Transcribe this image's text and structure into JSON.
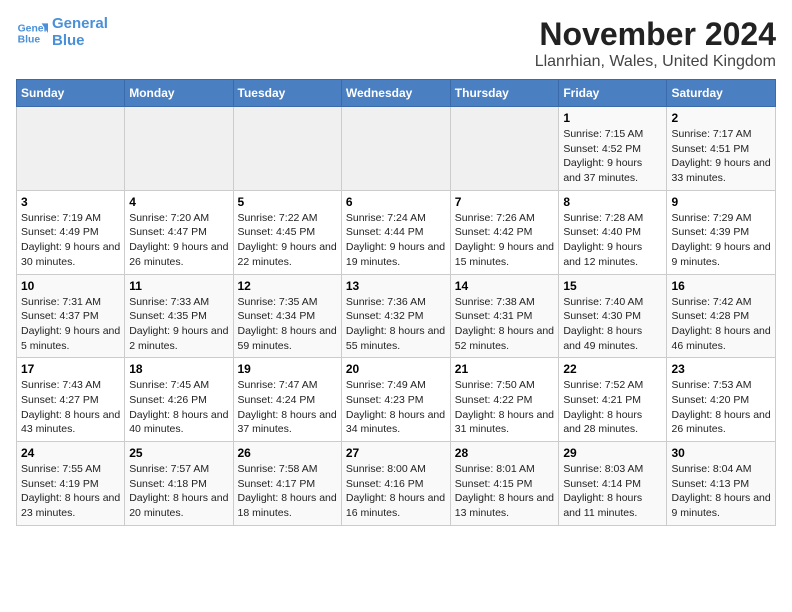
{
  "header": {
    "logo_line1": "General",
    "logo_line2": "Blue",
    "month": "November 2024",
    "location": "Llanrhian, Wales, United Kingdom"
  },
  "days_of_week": [
    "Sunday",
    "Monday",
    "Tuesday",
    "Wednesday",
    "Thursday",
    "Friday",
    "Saturday"
  ],
  "weeks": [
    [
      {
        "day": "",
        "info": ""
      },
      {
        "day": "",
        "info": ""
      },
      {
        "day": "",
        "info": ""
      },
      {
        "day": "",
        "info": ""
      },
      {
        "day": "",
        "info": ""
      },
      {
        "day": "1",
        "info": "Sunrise: 7:15 AM\nSunset: 4:52 PM\nDaylight: 9 hours and 37 minutes."
      },
      {
        "day": "2",
        "info": "Sunrise: 7:17 AM\nSunset: 4:51 PM\nDaylight: 9 hours and 33 minutes."
      }
    ],
    [
      {
        "day": "3",
        "info": "Sunrise: 7:19 AM\nSunset: 4:49 PM\nDaylight: 9 hours and 30 minutes."
      },
      {
        "day": "4",
        "info": "Sunrise: 7:20 AM\nSunset: 4:47 PM\nDaylight: 9 hours and 26 minutes."
      },
      {
        "day": "5",
        "info": "Sunrise: 7:22 AM\nSunset: 4:45 PM\nDaylight: 9 hours and 22 minutes."
      },
      {
        "day": "6",
        "info": "Sunrise: 7:24 AM\nSunset: 4:44 PM\nDaylight: 9 hours and 19 minutes."
      },
      {
        "day": "7",
        "info": "Sunrise: 7:26 AM\nSunset: 4:42 PM\nDaylight: 9 hours and 15 minutes."
      },
      {
        "day": "8",
        "info": "Sunrise: 7:28 AM\nSunset: 4:40 PM\nDaylight: 9 hours and 12 minutes."
      },
      {
        "day": "9",
        "info": "Sunrise: 7:29 AM\nSunset: 4:39 PM\nDaylight: 9 hours and 9 minutes."
      }
    ],
    [
      {
        "day": "10",
        "info": "Sunrise: 7:31 AM\nSunset: 4:37 PM\nDaylight: 9 hours and 5 minutes."
      },
      {
        "day": "11",
        "info": "Sunrise: 7:33 AM\nSunset: 4:35 PM\nDaylight: 9 hours and 2 minutes."
      },
      {
        "day": "12",
        "info": "Sunrise: 7:35 AM\nSunset: 4:34 PM\nDaylight: 8 hours and 59 minutes."
      },
      {
        "day": "13",
        "info": "Sunrise: 7:36 AM\nSunset: 4:32 PM\nDaylight: 8 hours and 55 minutes."
      },
      {
        "day": "14",
        "info": "Sunrise: 7:38 AM\nSunset: 4:31 PM\nDaylight: 8 hours and 52 minutes."
      },
      {
        "day": "15",
        "info": "Sunrise: 7:40 AM\nSunset: 4:30 PM\nDaylight: 8 hours and 49 minutes."
      },
      {
        "day": "16",
        "info": "Sunrise: 7:42 AM\nSunset: 4:28 PM\nDaylight: 8 hours and 46 minutes."
      }
    ],
    [
      {
        "day": "17",
        "info": "Sunrise: 7:43 AM\nSunset: 4:27 PM\nDaylight: 8 hours and 43 minutes."
      },
      {
        "day": "18",
        "info": "Sunrise: 7:45 AM\nSunset: 4:26 PM\nDaylight: 8 hours and 40 minutes."
      },
      {
        "day": "19",
        "info": "Sunrise: 7:47 AM\nSunset: 4:24 PM\nDaylight: 8 hours and 37 minutes."
      },
      {
        "day": "20",
        "info": "Sunrise: 7:49 AM\nSunset: 4:23 PM\nDaylight: 8 hours and 34 minutes."
      },
      {
        "day": "21",
        "info": "Sunrise: 7:50 AM\nSunset: 4:22 PM\nDaylight: 8 hours and 31 minutes."
      },
      {
        "day": "22",
        "info": "Sunrise: 7:52 AM\nSunset: 4:21 PM\nDaylight: 8 hours and 28 minutes."
      },
      {
        "day": "23",
        "info": "Sunrise: 7:53 AM\nSunset: 4:20 PM\nDaylight: 8 hours and 26 minutes."
      }
    ],
    [
      {
        "day": "24",
        "info": "Sunrise: 7:55 AM\nSunset: 4:19 PM\nDaylight: 8 hours and 23 minutes."
      },
      {
        "day": "25",
        "info": "Sunrise: 7:57 AM\nSunset: 4:18 PM\nDaylight: 8 hours and 20 minutes."
      },
      {
        "day": "26",
        "info": "Sunrise: 7:58 AM\nSunset: 4:17 PM\nDaylight: 8 hours and 18 minutes."
      },
      {
        "day": "27",
        "info": "Sunrise: 8:00 AM\nSunset: 4:16 PM\nDaylight: 8 hours and 16 minutes."
      },
      {
        "day": "28",
        "info": "Sunrise: 8:01 AM\nSunset: 4:15 PM\nDaylight: 8 hours and 13 minutes."
      },
      {
        "day": "29",
        "info": "Sunrise: 8:03 AM\nSunset: 4:14 PM\nDaylight: 8 hours and 11 minutes."
      },
      {
        "day": "30",
        "info": "Sunrise: 8:04 AM\nSunset: 4:13 PM\nDaylight: 8 hours and 9 minutes."
      }
    ]
  ]
}
